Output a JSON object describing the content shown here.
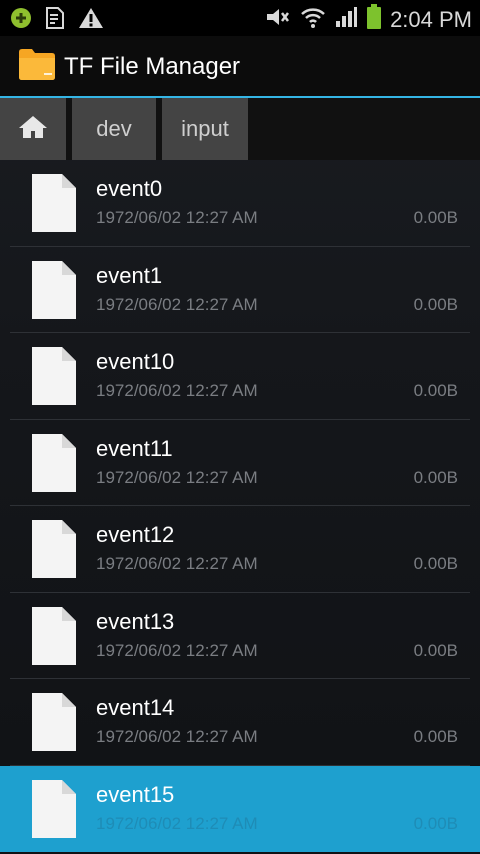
{
  "status_bar": {
    "time": "2:04 PM",
    "left_icons": [
      "android-debug-icon",
      "notification-doc-icon",
      "warning-icon"
    ],
    "right_icons": [
      "mute-icon",
      "wifi-icon",
      "signal-icon",
      "battery-icon"
    ]
  },
  "app_bar": {
    "title": "TF File Manager",
    "accent_color": "#34b5e5"
  },
  "breadcrumb": {
    "home_icon": "home-icon",
    "items": [
      "dev",
      "input"
    ]
  },
  "files": [
    {
      "name": "event0",
      "date": "1972/06/02 12:27 AM",
      "size": "0.00B",
      "selected": false
    },
    {
      "name": "event1",
      "date": "1972/06/02 12:27 AM",
      "size": "0.00B",
      "selected": false
    },
    {
      "name": "event10",
      "date": "1972/06/02 12:27 AM",
      "size": "0.00B",
      "selected": false
    },
    {
      "name": "event11",
      "date": "1972/06/02 12:27 AM",
      "size": "0.00B",
      "selected": false
    },
    {
      "name": "event12",
      "date": "1972/06/02 12:27 AM",
      "size": "0.00B",
      "selected": false
    },
    {
      "name": "event13",
      "date": "1972/06/02 12:27 AM",
      "size": "0.00B",
      "selected": false
    },
    {
      "name": "event14",
      "date": "1972/06/02 12:27 AM",
      "size": "0.00B",
      "selected": false
    },
    {
      "name": "event15",
      "date": "1972/06/02 12:27 AM",
      "size": "0.00B",
      "selected": true
    }
  ],
  "selected_color": "#1ea0cf"
}
